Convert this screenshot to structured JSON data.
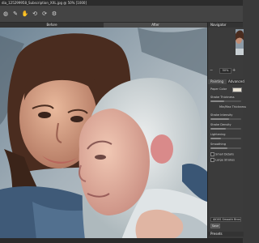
{
  "window": {
    "title": "dia_125299958_Subscription_XXL.jpg @ 50% [1000]"
  },
  "toolbar": {
    "tools": [
      {
        "icon": "crop-icon",
        "glyph": "◍"
      },
      {
        "icon": "brush-icon",
        "glyph": "✎"
      },
      {
        "icon": "hand-icon",
        "glyph": "✋"
      },
      {
        "icon": "undo-icon",
        "glyph": "⟲"
      },
      {
        "icon": "redo-icon",
        "glyph": "⟳"
      },
      {
        "icon": "settings-icon",
        "glyph": "⚙"
      }
    ]
  },
  "view_tabs": {
    "before": "Before",
    "after": "After"
  },
  "panel": {
    "navigator_title": "Navigator",
    "zoom_value": "50%",
    "tabs": [
      "Painting",
      "Advanced"
    ],
    "settings": [
      {
        "label": "Paper Color",
        "kind": "label"
      },
      {
        "label": "Stroke Thickness",
        "kind": "slider",
        "level": 0.45
      },
      {
        "label": "Min/Max Thickness",
        "kind": "label"
      },
      {
        "label": "Stroke Intensity",
        "kind": "slider",
        "level": 0.6
      },
      {
        "label": "Stroke Density",
        "kind": "slider",
        "level": 0.5
      },
      {
        "label": "Lightening",
        "kind": "slider",
        "level": 0.35
      },
      {
        "label": "Smoothing",
        "kind": "slider",
        "level": 0.55
      }
    ],
    "checks": [
      {
        "label": "Small Details"
      },
      {
        "label": "Large Strokes"
      }
    ],
    "presets_title": "Presets",
    "preset_value": "AKVIS Smooth Brush",
    "save_label": "Save"
  },
  "colors": {
    "ui_dark": "#3a3a3a",
    "panel": "#3b3b3b",
    "accent": "#8c9aa6"
  }
}
